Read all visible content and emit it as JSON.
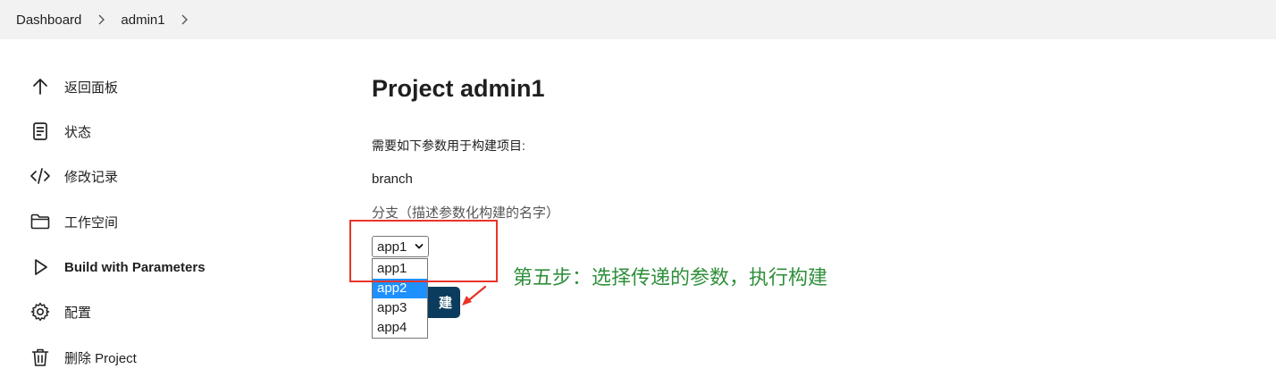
{
  "breadcrumb": {
    "items": [
      "Dashboard",
      "admin1"
    ]
  },
  "sidebar": {
    "items": [
      {
        "label": "返回面板",
        "icon": "arrow-up-icon"
      },
      {
        "label": "状态",
        "icon": "document-icon"
      },
      {
        "label": "修改记录",
        "icon": "code-icon"
      },
      {
        "label": "工作空间",
        "icon": "folder-icon"
      },
      {
        "label": "Build with Parameters",
        "icon": "play-icon"
      },
      {
        "label": "配置",
        "icon": "gear-icon"
      },
      {
        "label": "删除 Project",
        "icon": "trash-icon"
      }
    ]
  },
  "main": {
    "title": "Project admin1",
    "description": "需要如下参数用于构建项目:",
    "param": {
      "name": "branch",
      "description": "分支（描述参数化构建的名字）",
      "selected": "app1",
      "options": [
        "app1",
        "app2",
        "app3",
        "app4"
      ],
      "highlighted": "app2"
    },
    "build_button": "建"
  },
  "annotation": {
    "note": "第五步：选择传递的参数，执行构建",
    "box_color": "#e8332a",
    "note_color": "#2f8f3b"
  }
}
